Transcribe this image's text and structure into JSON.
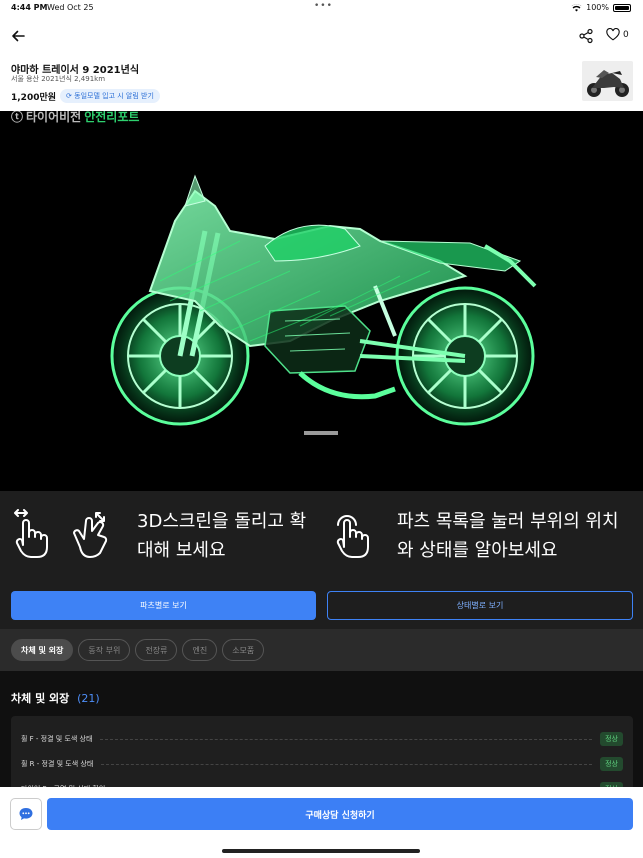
{
  "status": {
    "time": "4:44 PM",
    "date": "Wed Oct 25",
    "battery": "100%",
    "battery_level": 1.0
  },
  "header": {
    "like_count": "0",
    "title": "야마하 트레이서 9 2021년식",
    "subtitle": "서울 용산 2021년식 2,491km",
    "price": "1,200만원",
    "alert_pill": "동일모델 입고 시 알림 받기"
  },
  "hero": {
    "brand": "타이어비전",
    "brand_accent": "안전리포트"
  },
  "guide": {
    "text_left": "3D스크린을 돌리고 확대해 보세요",
    "text_right": "파츠 목록을 눌러 부위의 위치와 상태를 알아보세요",
    "btn_parts": "파츠별로 보기",
    "btn_status": "상태별로 보기"
  },
  "filters": [
    "차체 및 외장",
    "동작 부위",
    "전장류",
    "엔진",
    "소모품"
  ],
  "section": {
    "title": "차체 및 외장",
    "count": "(21)",
    "rows": [
      {
        "label": "휠 F - 정결 및 도색 상태",
        "status": "정상"
      },
      {
        "label": "휠 R - 정결 및 도색 상태",
        "status": "정상"
      },
      {
        "label": "타이어 F - 균열 및 상태 확인",
        "status": "정상"
      }
    ]
  },
  "bottom": {
    "cta": "구매상담 신청하기"
  },
  "colors": {
    "accent": "#3e82f5",
    "wireframe": "#2ee87a",
    "ok_badge": "#5fd07e"
  }
}
